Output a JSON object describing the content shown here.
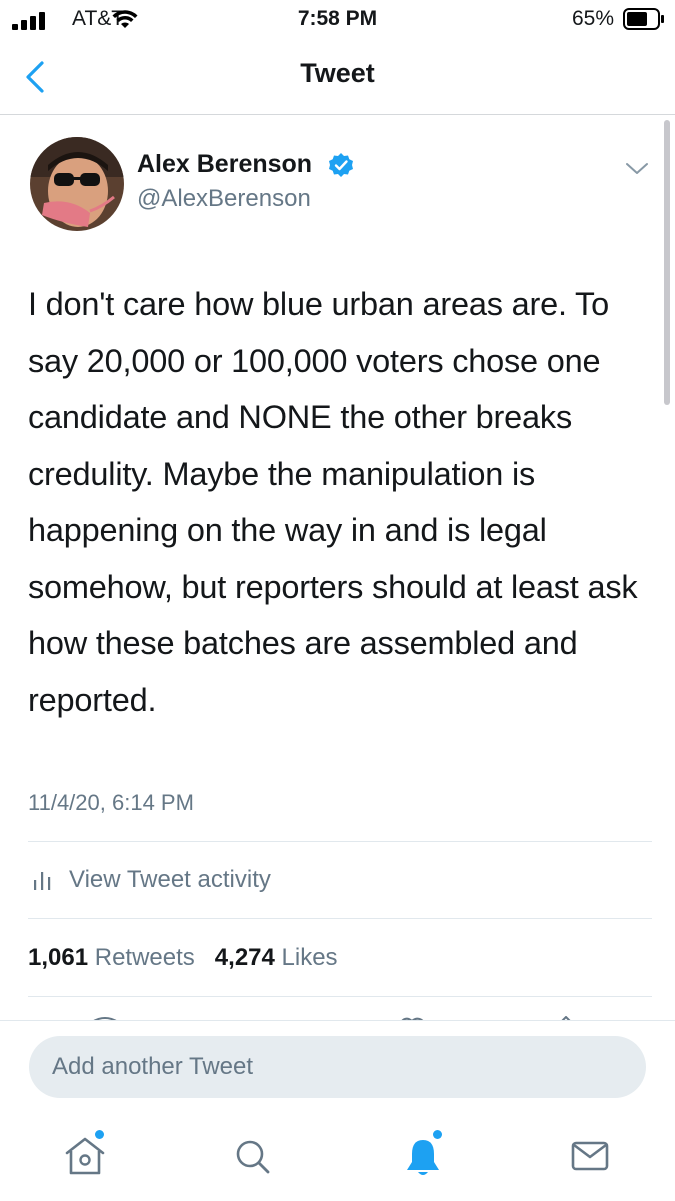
{
  "status_bar": {
    "carrier": "AT&T",
    "time": "7:58 PM",
    "battery": "65%"
  },
  "nav": {
    "title": "Tweet",
    "back_icon": "chevron-left-icon"
  },
  "tweet": {
    "author_name": "Alex Berenson",
    "author_handle": "@AlexBerenson",
    "verified": true,
    "text": "I don't care how blue urban areas are. To say 20,000 or 100,000 voters chose one candidate and NONE the other breaks credulity. Maybe the manipulation is happening on the way in and is legal somehow, but reporters should at least ask how these batches are assembled and reported.",
    "timestamp": "11/4/20, 6:14 PM",
    "activity_label": "View Tweet activity",
    "retweets_count": "1,061",
    "retweets_label": "Retweets",
    "likes_count": "4,274",
    "likes_label": "Likes"
  },
  "compose": {
    "placeholder": "Add another Tweet"
  },
  "tab_bar": {
    "items": [
      "home-icon",
      "search-icon",
      "notifications-icon",
      "messages-icon"
    ]
  },
  "colors": {
    "accent": "#1da1f2",
    "secondary_text": "#657786",
    "primary_text": "#14171a"
  }
}
